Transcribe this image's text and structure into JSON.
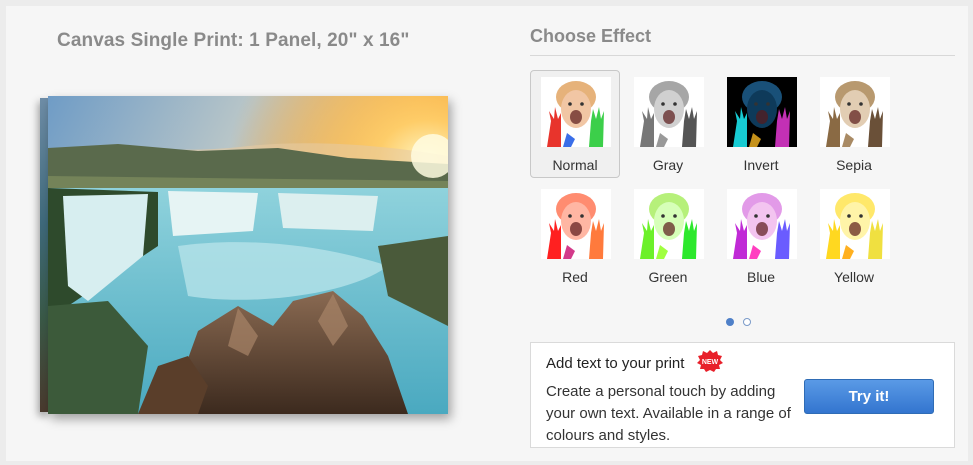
{
  "product": {
    "title": "Canvas Single Print: 1 Panel, 20\" x 16\""
  },
  "effects_panel": {
    "title": "Choose Effect",
    "selected": "Normal",
    "effects": [
      {
        "label": "Normal",
        "skin": "#f1c6a4",
        "hair": "#e6b27a",
        "bg": "#ffffff",
        "hands": [
          "#e8342c",
          "#3ccf4a",
          "#3a6ee8"
        ]
      },
      {
        "label": "Gray",
        "skin": "#d0d0d0",
        "hair": "#a6a6a6",
        "bg": "#ffffff",
        "hands": [
          "#777777",
          "#555555",
          "#999999"
        ]
      },
      {
        "label": "Invert",
        "skin": "#0e3a5a",
        "hair": "#195078",
        "bg": "#000000",
        "hands": [
          "#17cbd3",
          "#c330b5",
          "#c5911a"
        ]
      },
      {
        "label": "Sepia",
        "skin": "#e2cdb3",
        "hair": "#b8996f",
        "bg": "#ffffff",
        "hands": [
          "#8a6a44",
          "#6a5038",
          "#a98a64"
        ]
      },
      {
        "label": "Red",
        "skin": "#ffb6a3",
        "hair": "#ff8c70",
        "bg": "#ffffff",
        "hands": [
          "#ff2020",
          "#ff7a3c",
          "#d33a8a"
        ]
      },
      {
        "label": "Green",
        "skin": "#d6ffb8",
        "hair": "#b6f07a",
        "bg": "#ffffff",
        "hands": [
          "#6cf02a",
          "#2ce82c",
          "#a0ff40"
        ]
      },
      {
        "label": "Blue",
        "skin": "#f3c4f0",
        "hair": "#e29ae8",
        "bg": "#ffffff",
        "hands": [
          "#c02ad6",
          "#6a5cff",
          "#ff3ec0"
        ]
      },
      {
        "label": "Yellow",
        "skin": "#fff4a8",
        "hair": "#ffe86a",
        "bg": "#ffffff",
        "hands": [
          "#ffd820",
          "#f0e040",
          "#ffb020"
        ]
      }
    ],
    "pagination": {
      "current": 1,
      "total": 2
    }
  },
  "add_text": {
    "title": "Add text to your print",
    "badge": "NEW",
    "description": "Create a personal touch by adding your own text. Available in a range of colours and styles.",
    "button_label": "Try it!"
  },
  "colors": {
    "accent": "#3d80d8",
    "badge": "#e8202a"
  }
}
